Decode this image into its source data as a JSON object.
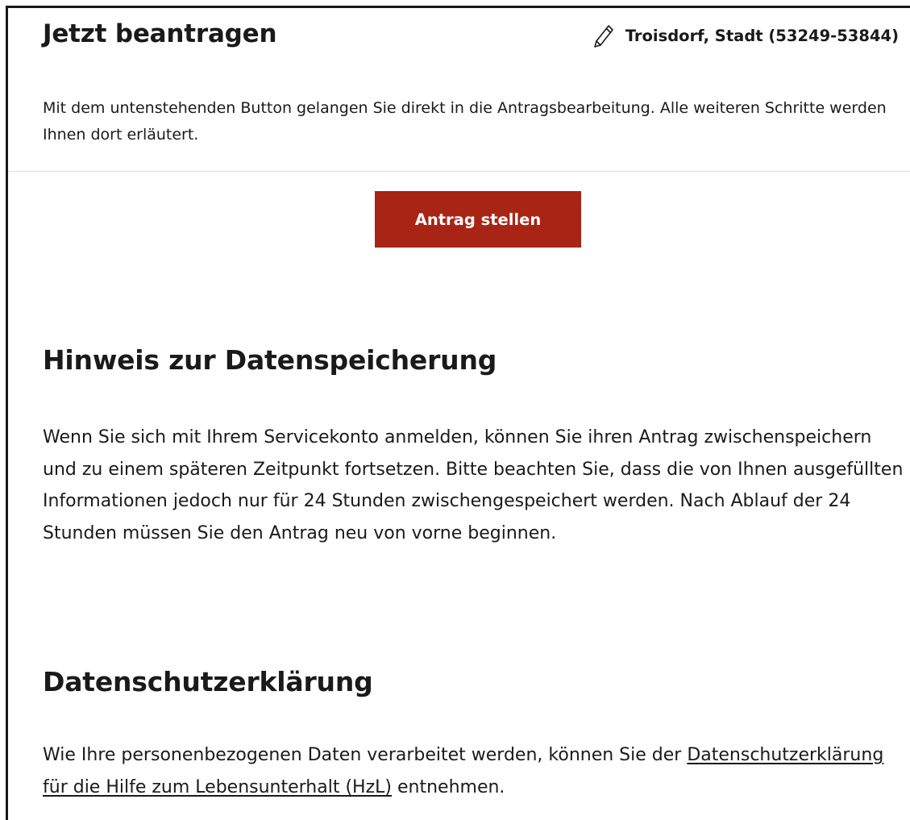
{
  "card": {
    "title": "Jetzt beantragen",
    "location": "Troisdorf, Stadt (53249-53844)",
    "location_icon": "pencil-icon",
    "intro": "Mit dem untenstehenden Button gelangen Sie direkt in die Antragsbearbeitung. Alle weiteren Schritte werden Ihnen dort erläutert.",
    "button_label": "Antrag stellen",
    "button_color": "#a82414"
  },
  "storage_notice": {
    "title": "Hinweis zur Datenspeicherung",
    "text": "Wenn Sie sich mit Ihrem Servicekonto anmelden, können Sie ihren Antrag zwischenspeichern und zu einem späteren Zeitpunkt fortsetzen. Bitte beachten Sie, dass die von Ihnen ausgefüllten Informationen jedoch nur für 24 Stunden zwischengespeichert werden. Nach Ablauf der 24 Stunden müssen Sie den Antrag neu von vorne beginnen."
  },
  "privacy": {
    "title": "Datenschutzerklärung",
    "text_before": "Wie Ihre personenbezogenen Daten verarbeitet werden, können Sie der",
    "link_text": "Datenschutzerklärung für die Hilfe zum Lebensunterhalt (HzL)",
    "text_after": "entnehmen."
  }
}
